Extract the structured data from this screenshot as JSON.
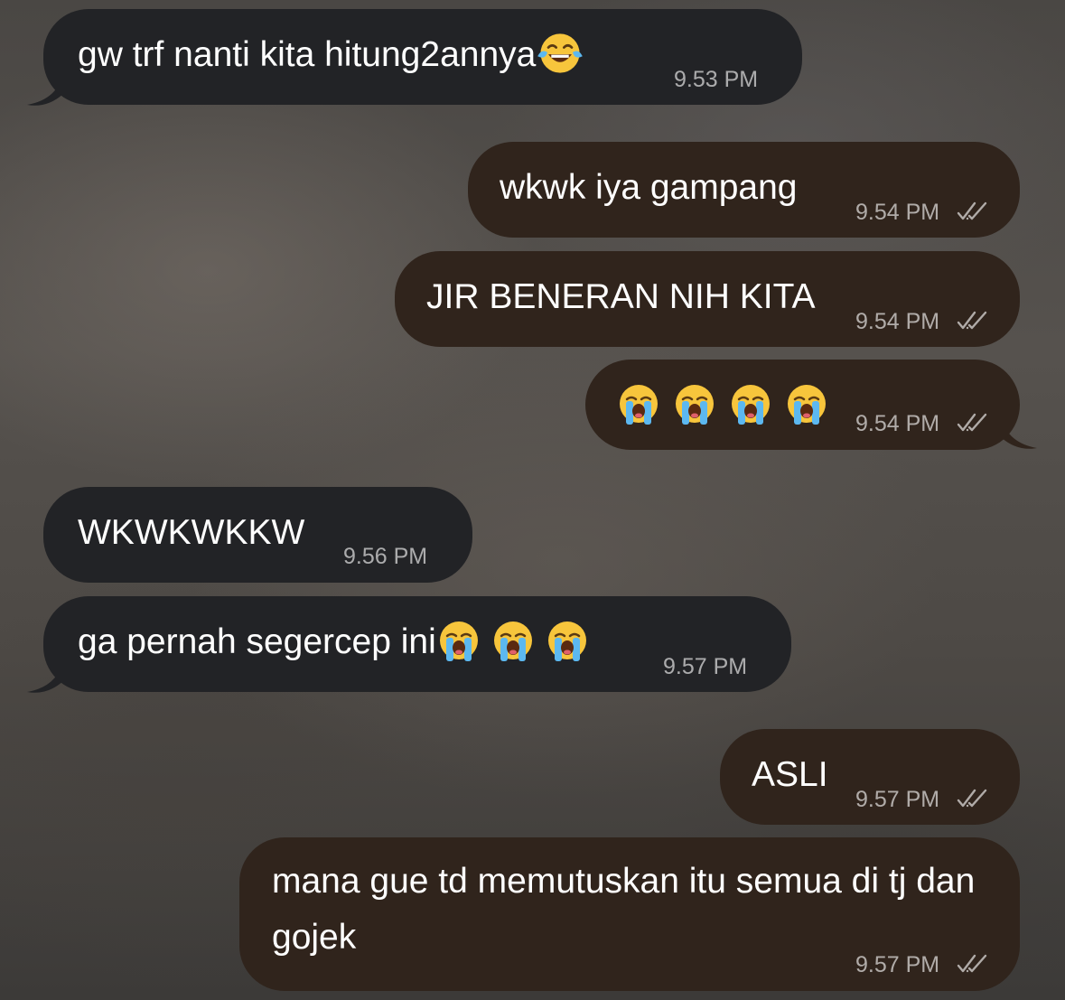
{
  "messages": [
    {
      "direction": "incoming",
      "text": "gw trf nanti kita hitung2annya",
      "emojis": [
        "joy-emoji"
      ],
      "time": "9.53 PM"
    },
    {
      "direction": "outgoing",
      "text": "wkwk iya gampang",
      "time": "9.54 PM",
      "read": true
    },
    {
      "direction": "outgoing",
      "text": "JIR BENERAN NIH KITA",
      "time": "9.54 PM",
      "read": true
    },
    {
      "direction": "outgoing",
      "text": "",
      "emojis": [
        "loudly-crying-emoji",
        "loudly-crying-emoji",
        "loudly-crying-emoji",
        "loudly-crying-emoji"
      ],
      "time": "9.54 PM",
      "read": true
    },
    {
      "direction": "incoming",
      "text": "WKWKWKKW",
      "time": "9.56 PM"
    },
    {
      "direction": "incoming",
      "text": "ga pernah segercep ini",
      "emojis": [
        "loudly-crying-emoji",
        "loudly-crying-emoji",
        "loudly-crying-emoji"
      ],
      "time": "9.57 PM"
    },
    {
      "direction": "outgoing",
      "text": "ASLI",
      "time": "9.57 PM",
      "read": true
    },
    {
      "direction": "outgoing",
      "text": "mana gue td memutuskan itu semua di tj dan gojek",
      "time": "9.57 PM",
      "read": true
    }
  ],
  "colors": {
    "incoming_bubble": "#222326",
    "outgoing_bubble": "#30241c",
    "text": "#ffffff",
    "timestamp": "#a8a6a4"
  }
}
